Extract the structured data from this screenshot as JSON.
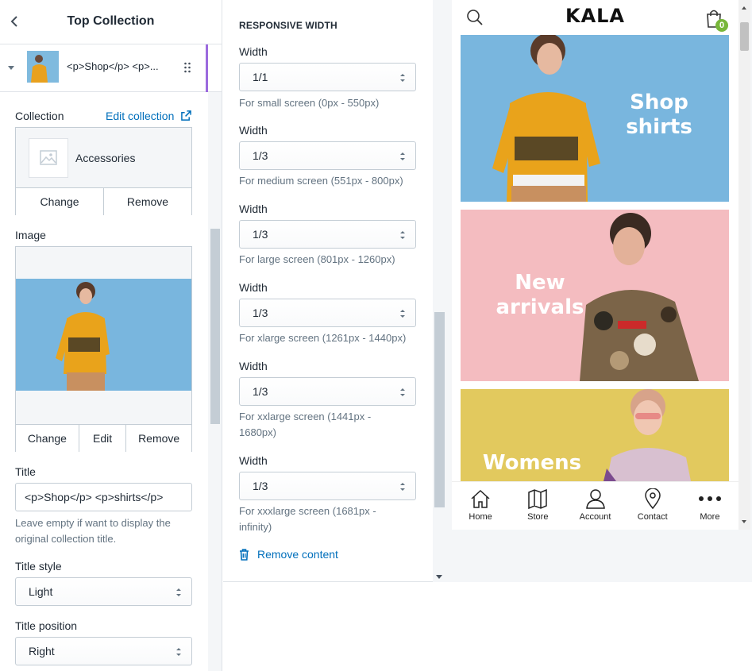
{
  "sidebar": {
    "header_title": "Top Collection",
    "block_name": "<p>Shop</p> <p>...",
    "collection": {
      "label": "Collection",
      "edit_link": "Edit collection",
      "name": "Accessories",
      "change": "Change",
      "remove": "Remove"
    },
    "image": {
      "label": "Image",
      "change": "Change",
      "edit": "Edit",
      "remove": "Remove"
    },
    "title": {
      "label": "Title",
      "value": "<p>Shop</p> <p>shirts</p>",
      "help": "Leave empty if want to display the original collection title."
    },
    "title_style": {
      "label": "Title style",
      "value": "Light"
    },
    "title_position": {
      "label": "Title position",
      "value": "Right"
    }
  },
  "responsive": {
    "heading": "RESPONSIVE WIDTH",
    "fields": [
      {
        "label": "Width",
        "value": "1/1",
        "help": "For small screen (0px - 550px)"
      },
      {
        "label": "Width",
        "value": "1/3",
        "help": "For medium screen (551px - 800px)"
      },
      {
        "label": "Width",
        "value": "1/3",
        "help": "For large screen (801px - 1260px)"
      },
      {
        "label": "Width",
        "value": "1/3",
        "help": "For xlarge screen (1261px - 1440px)"
      },
      {
        "label": "Width",
        "value": "1/3",
        "help": "For xxlarge screen (1441px - 1680px)"
      },
      {
        "label": "Width",
        "value": "1/3",
        "help": "For xxxlarge screen (1681px - infinity)"
      }
    ],
    "remove_content": "Remove content"
  },
  "preview": {
    "logo": "KALA",
    "cart_count": "0",
    "banners": [
      {
        "text_line1": "Shop",
        "text_line2": "shirts",
        "color": "#79b6de"
      },
      {
        "text_line1": "New",
        "text_line2": "arrivals",
        "color": "#f4bcc0"
      },
      {
        "text_line1": "Womens",
        "text_line2": "",
        "color": "#e2c95e"
      }
    ],
    "nav": [
      "Home",
      "Store",
      "Account",
      "Contact",
      "More"
    ]
  },
  "colors": {
    "accent": "#9c6ade",
    "link": "#006fbb",
    "badge": "#78b73a"
  }
}
